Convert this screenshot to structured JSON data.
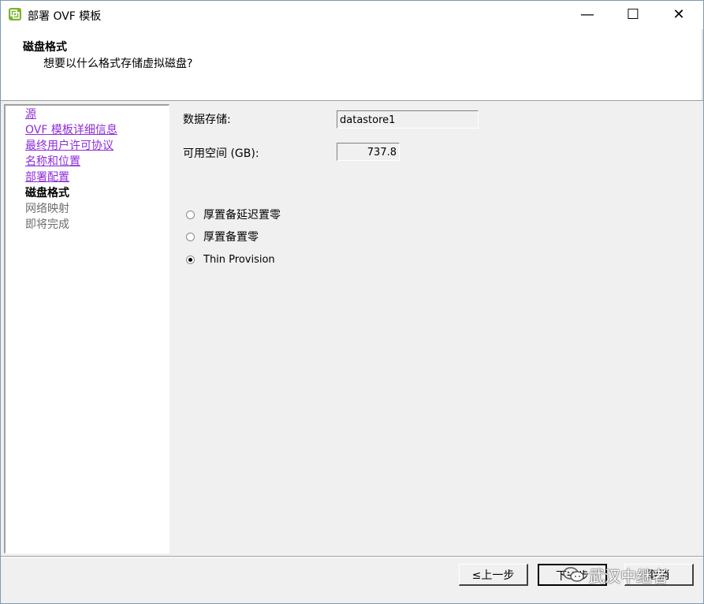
{
  "window": {
    "title": "部署 OVF 模板",
    "controls": {
      "minimize": "—",
      "maximize": "☐",
      "close": "✕"
    }
  },
  "header": {
    "title": "磁盘格式",
    "subtitle": "想要以什么格式存储虚拟磁盘?"
  },
  "sidebar": {
    "items": [
      {
        "label": "源",
        "state": "link"
      },
      {
        "label": "OVF 模板详细信息",
        "state": "link"
      },
      {
        "label": "最终用户许可协议",
        "state": "link"
      },
      {
        "label": "名称和位置",
        "state": "link"
      },
      {
        "label": "部署配置",
        "state": "link"
      },
      {
        "label": "磁盘格式",
        "state": "current"
      },
      {
        "label": "网络映射",
        "state": "future"
      },
      {
        "label": "即将完成",
        "state": "future"
      }
    ]
  },
  "main": {
    "datastore_label": "数据存储:",
    "datastore_value": "datastore1",
    "space_label": "可用空间 (GB):",
    "space_value": "737.8",
    "options": [
      {
        "label": "厚置备延迟置零",
        "checked": false
      },
      {
        "label": "厚置备置零",
        "checked": false
      },
      {
        "label": "Thin Provision",
        "checked": true
      }
    ]
  },
  "footer": {
    "back_label": "≤上一步",
    "next_label": "下一步",
    "cancel_label": "取消"
  },
  "watermark": {
    "text": "武汉中继者",
    "icon": "wechat-icon"
  },
  "colors": {
    "link": "#8e2bd9",
    "disabled": "#6d6d6d",
    "accent": "#7ab32e"
  }
}
